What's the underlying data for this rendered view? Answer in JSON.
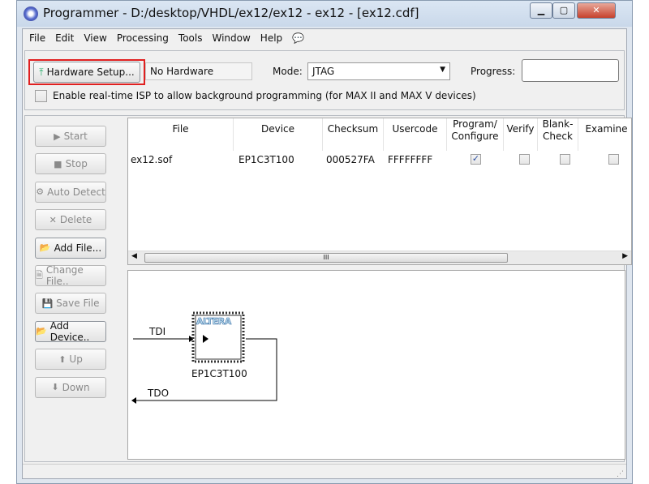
{
  "window": {
    "title": "Programmer - D:/desktop/VHDL/ex12/ex12 - ex12 - [ex12.cdf]"
  },
  "menu": [
    "File",
    "Edit",
    "View",
    "Processing",
    "Tools",
    "Window",
    "Help"
  ],
  "toolbar": {
    "hardware_setup": "Hardware Setup...",
    "hardware_value": "No Hardware",
    "mode_label": "Mode:",
    "mode_value": "JTAG",
    "progress_label": "Progress:",
    "progress_value": "",
    "isp_label": "Enable real-time ISP to allow background programming (for MAX II and MAX V devices)",
    "isp_checked": false
  },
  "highlight_color": "#e02020",
  "side_buttons": [
    {
      "label": "Start",
      "enabled": false,
      "icon": "start-icon"
    },
    {
      "label": "Stop",
      "enabled": false,
      "icon": "stop-icon"
    },
    {
      "label": "Auto Detect",
      "enabled": false,
      "icon": "auto-detect-icon"
    },
    {
      "label": "Delete",
      "enabled": false,
      "icon": "delete-icon"
    },
    {
      "label": "Add File...",
      "enabled": true,
      "icon": "folder-icon"
    },
    {
      "label": "Change File..",
      "enabled": false,
      "icon": "change-file-icon"
    },
    {
      "label": "Save File",
      "enabled": false,
      "icon": "save-icon"
    },
    {
      "label": "Add Device..",
      "enabled": true,
      "icon": "add-device-icon"
    },
    {
      "label": "Up",
      "enabled": false,
      "icon": "up-arrow-icon"
    },
    {
      "label": "Down",
      "enabled": false,
      "icon": "down-arrow-icon"
    }
  ],
  "table": {
    "columns": [
      "File",
      "Device",
      "Checksum",
      "Usercode",
      "Program/ Configure",
      "Verify",
      "Blank- Check",
      "Examine"
    ],
    "rows": [
      {
        "file": "ex12.sof",
        "device": "EP1C3T100",
        "checksum": "000527FA",
        "usercode": "FFFFFFFF",
        "program": true,
        "verify": false,
        "blank_check": false,
        "examine": false
      }
    ]
  },
  "diagram": {
    "tdi": "TDI",
    "tdo": "TDO",
    "device": "EP1C3T100",
    "logo": "ALTERA"
  }
}
